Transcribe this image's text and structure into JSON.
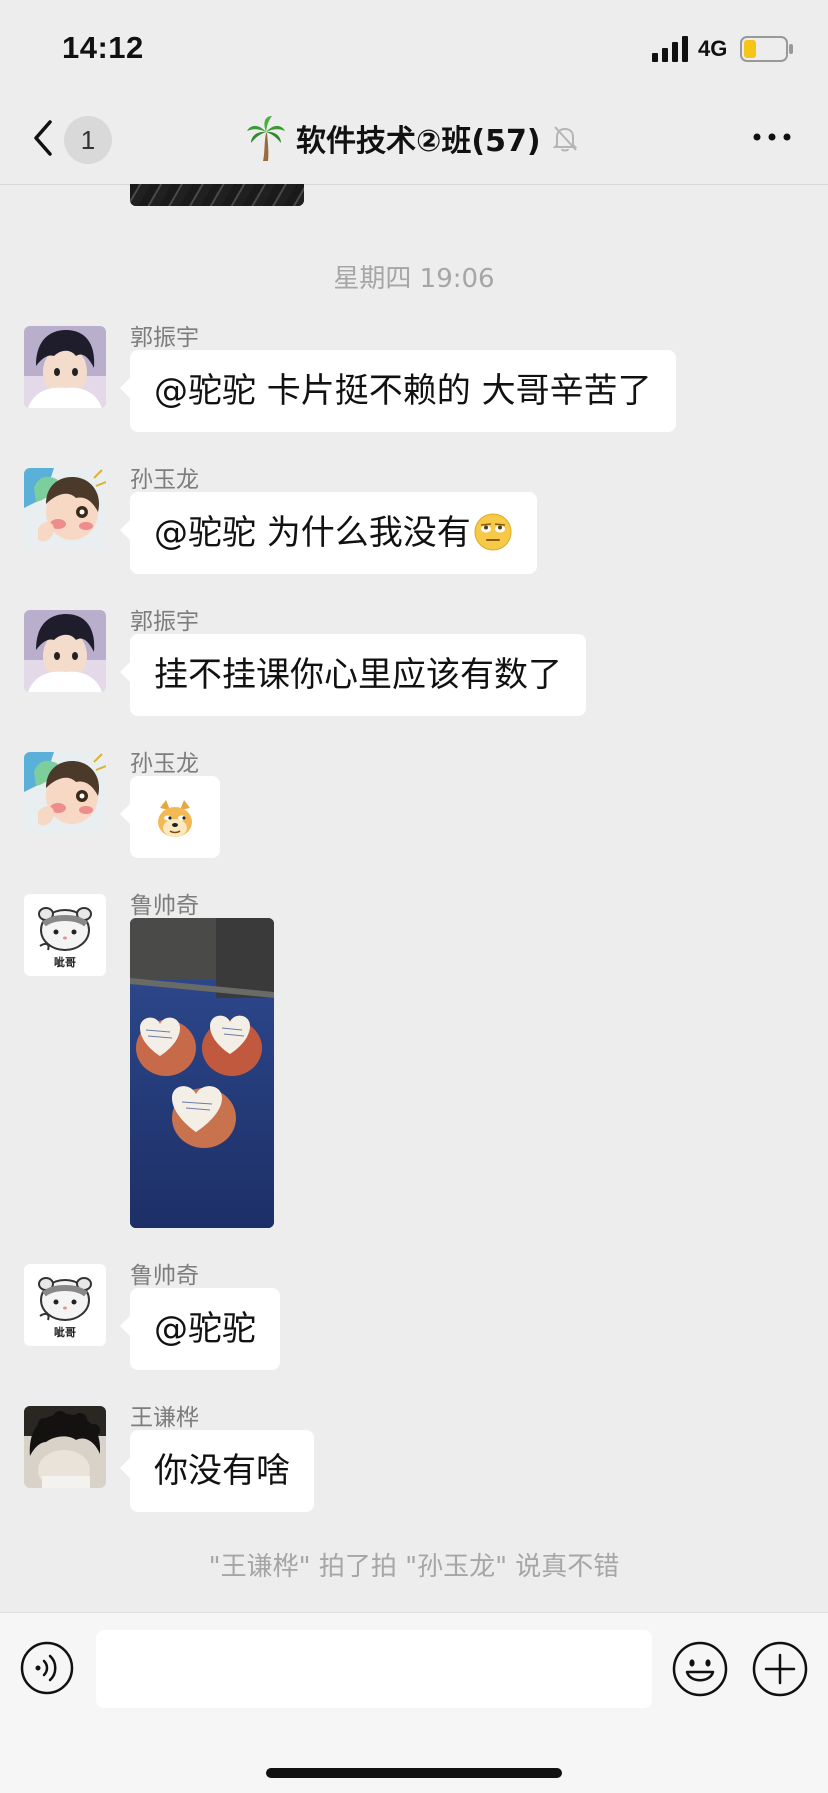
{
  "status_bar": {
    "time": "14:12",
    "network": "4G"
  },
  "nav": {
    "unread_count": "1",
    "title": "软件技术②班(57)"
  },
  "timestamp": "星期四 19:06",
  "messages": [
    {
      "sender": "郭振宇",
      "text": "@驼驼 卡片挺不赖的 大哥辛苦了"
    },
    {
      "sender": "孙玉龙",
      "text": "@驼驼 为什么我没有"
    },
    {
      "sender": "郭振宇",
      "text": "挂不挂课你心里应该有数了"
    },
    {
      "sender": "孙玉龙",
      "text": ""
    },
    {
      "sender": "鲁帅奇",
      "text": ""
    },
    {
      "sender": "鲁帅奇",
      "text": "@驼驼"
    },
    {
      "sender": "王谦桦",
      "text": "你没有啥"
    }
  ],
  "system_notice": "\"王谦桦\" 拍了拍 \"孙玉龙\" 说真不错",
  "avatar_captions": {
    "hamster": "呲哥"
  },
  "icons": {
    "back": "chevron-left-icon",
    "title_emoji": "palm-tree-icon",
    "mute": "bell-slash-icon",
    "more": "more-dots-icon",
    "voice": "voice-icon",
    "emoji": "emoji-icon",
    "plus": "plus-icon"
  }
}
